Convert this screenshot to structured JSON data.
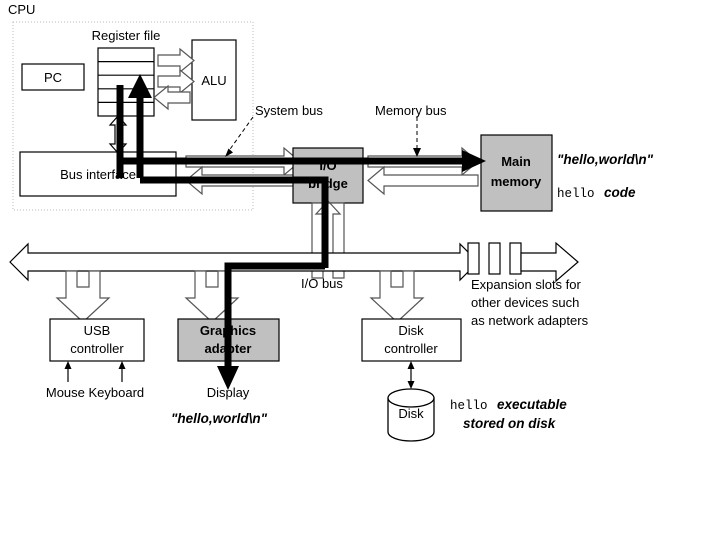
{
  "diagram": {
    "title": "CPU",
    "cpu_label": "CPU",
    "blocks": {
      "pc": "PC",
      "register_file": "Register file",
      "alu": "ALU",
      "bus_interface": "Bus interface",
      "io_bridge_line1": "I/O",
      "io_bridge_line2": "bridge",
      "main_memory_line1": "Main",
      "main_memory_line2": "memory",
      "usb_controller_line1": "USB",
      "usb_controller_line2": "controller",
      "graphics_adapter_line1": "Graphics",
      "graphics_adapter_line2": "adapter",
      "disk_controller_line1": "Disk",
      "disk_controller_line2": "controller",
      "disk": "Disk"
    },
    "bus_labels": {
      "system_bus": "System bus",
      "memory_bus": "Memory bus",
      "io_bus": "I/O bus"
    },
    "annotations": {
      "memory_string": "\"hello,world\\n\"",
      "memory_code_mono": "hello",
      "memory_code_rest": "code",
      "expansion_line1": "Expansion slots for",
      "expansion_line2": "other devices such",
      "expansion_line3": "as network adapters",
      "mouse_keyboard": "Mouse Keyboard",
      "display": "Display",
      "display_string": "\"hello,world\\n\"",
      "disk_note_mono": "hello",
      "disk_note_rest_line1": "executable",
      "disk_note_line2": "stored on disk"
    },
    "colors": {
      "shaded_block": "#c0c0c0",
      "outline": "#000000",
      "bus_outline": "#555555",
      "cpu_border": "#b9b9b9",
      "background": "#ffffff"
    }
  }
}
